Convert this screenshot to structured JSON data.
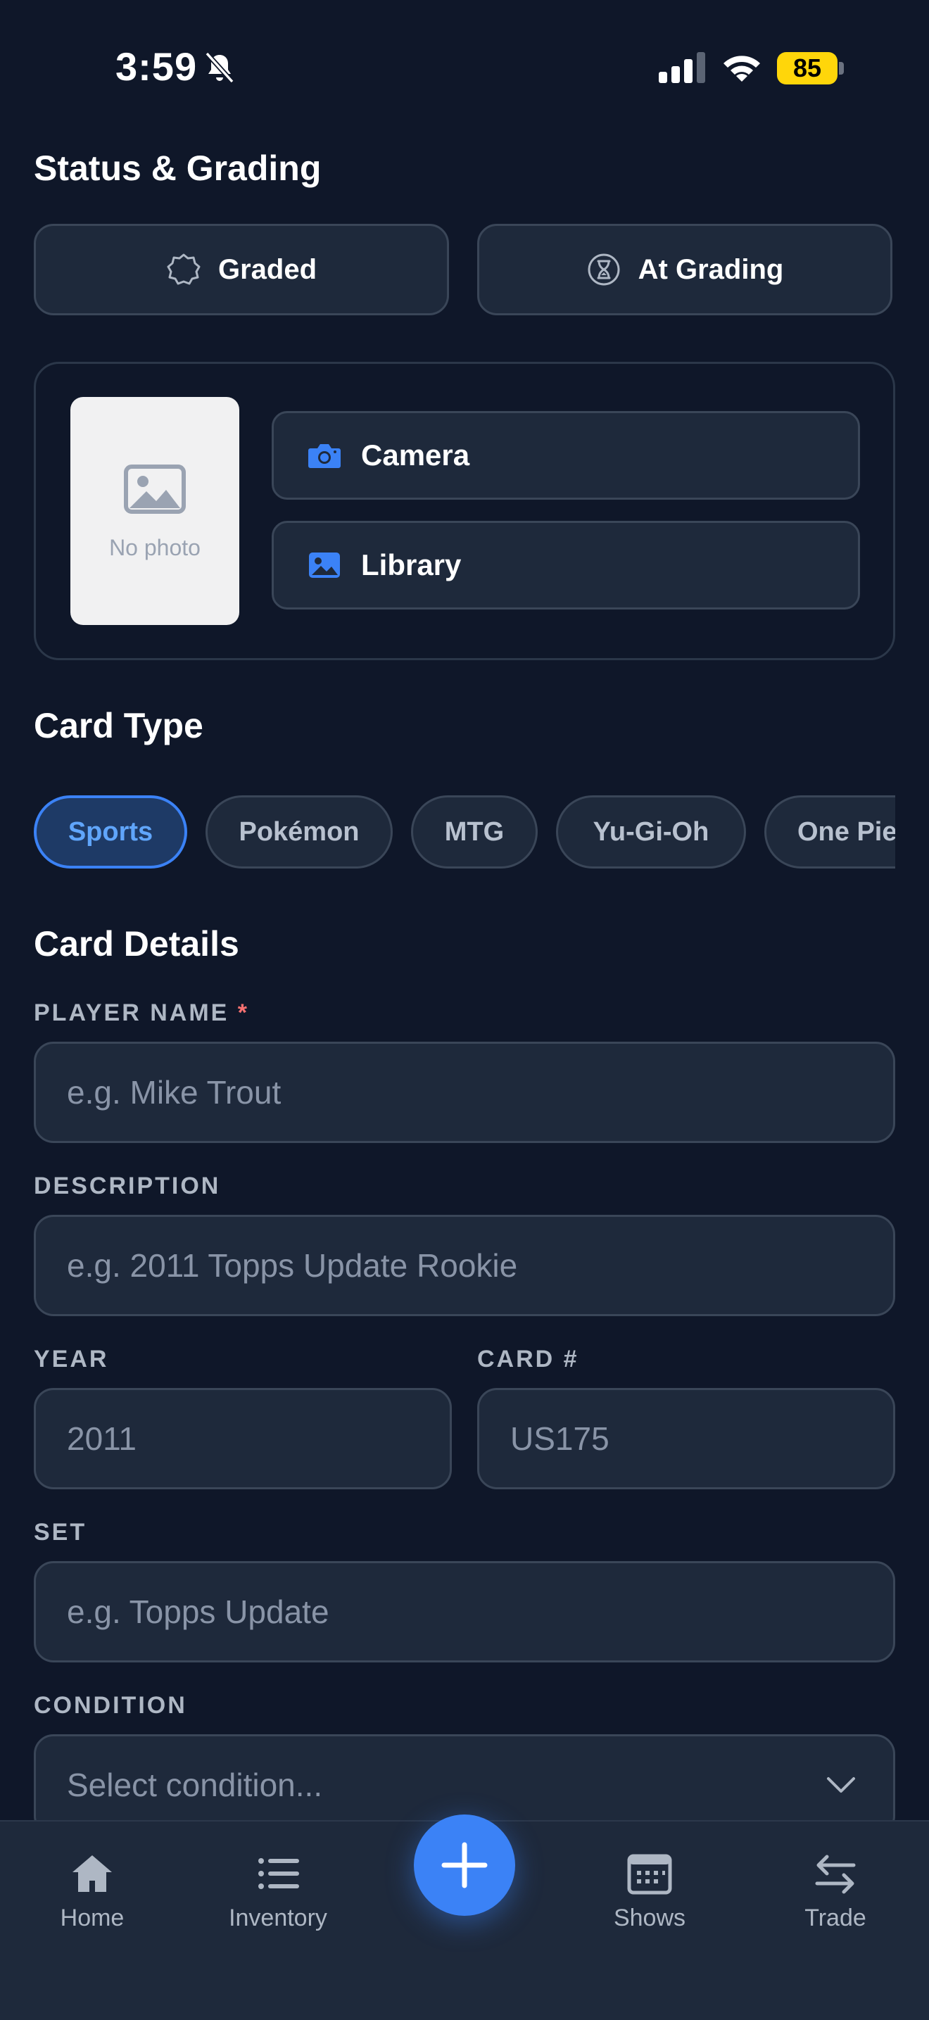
{
  "status_bar": {
    "time": "3:59",
    "battery": "85"
  },
  "status_grading": {
    "title": "Status & Grading",
    "graded_label": "Graded",
    "at_grading_label": "At Grading"
  },
  "photo": {
    "placeholder_text": "No photo",
    "camera_label": "Camera",
    "library_label": "Library"
  },
  "card_type": {
    "title": "Card Type",
    "options": [
      "Sports",
      "Pokémon",
      "MTG",
      "Yu-Gi-Oh",
      "One Piece"
    ],
    "selected": "Sports"
  },
  "card_details": {
    "title": "Card Details",
    "player_name": {
      "label": "PLAYER NAME",
      "required_mark": "*",
      "placeholder": "e.g. Mike Trout"
    },
    "description": {
      "label": "DESCRIPTION",
      "placeholder": "e.g. 2011 Topps Update Rookie"
    },
    "year": {
      "label": "YEAR",
      "placeholder": "2011"
    },
    "card_number": {
      "label": "CARD #",
      "placeholder": "US175"
    },
    "set": {
      "label": "SET",
      "placeholder": "e.g. Topps Update"
    },
    "condition": {
      "label": "CONDITION",
      "placeholder": "Select condition..."
    }
  },
  "nav": {
    "items": [
      {
        "label": "Home",
        "icon": "home-icon"
      },
      {
        "label": "Inventory",
        "icon": "list-icon"
      },
      {
        "label": "Shows",
        "icon": "calendar-icon"
      },
      {
        "label": "Trade",
        "icon": "swap-arrows-icon"
      }
    ],
    "fab_icon": "plus-icon"
  },
  "colors": {
    "background": "#0f1729",
    "surface": "#1e293b",
    "accent": "#3b82f6",
    "required": "#f87171",
    "battery": "#ffd60a"
  }
}
